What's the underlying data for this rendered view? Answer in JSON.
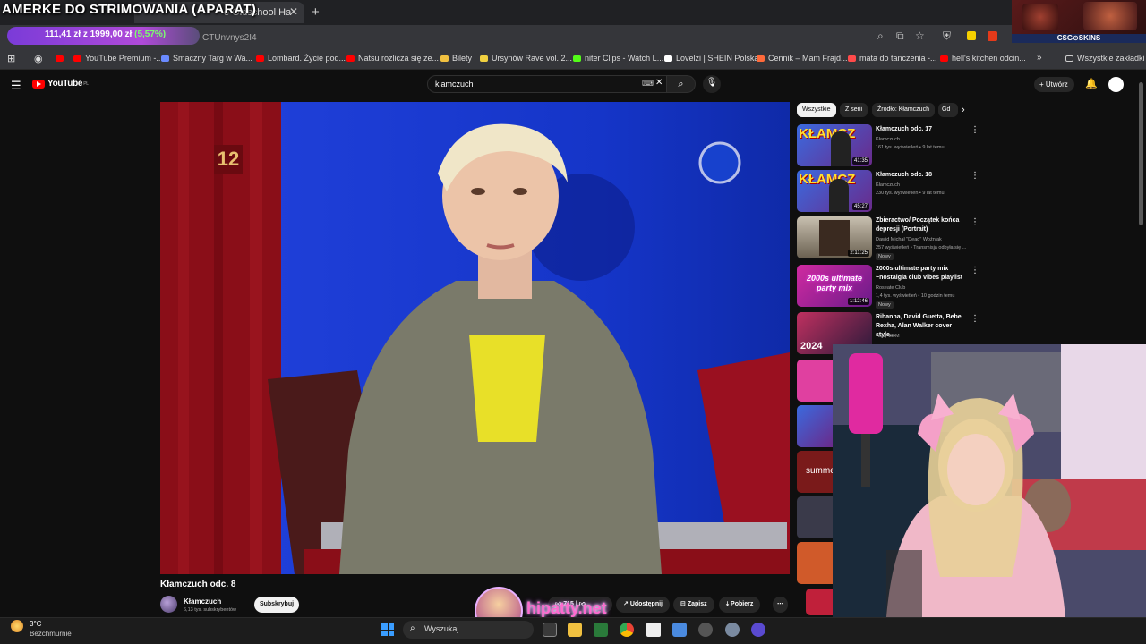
{
  "overlay": {
    "title": "AMERKE DO STRIMOWANIA (APARAT)",
    "goal_current": "111,41 zł",
    "goal_between": "z",
    "goal_target": "1999,00 zł",
    "goal_percent": "(5,57%)",
    "brand": "hipatty.net",
    "csgo_label": "CSG⊙SKINS"
  },
  "browser": {
    "tab_title": "e Oldschool Ha",
    "url_fragment": "CTUnvnys2I4",
    "bookmarks": [
      {
        "label": "YouTube Premium -...",
        "color": "#ff0000"
      },
      {
        "label": "Smaczny Targ w Wa...",
        "color": "#6a8aff"
      },
      {
        "label": "Lombard. Życie pod...",
        "color": "#ff0000"
      },
      {
        "label": "Natsu rozlicza się ze...",
        "color": "#ff0000"
      },
      {
        "label": "Bilety",
        "color": "#f0c040"
      },
      {
        "label": "Ursynów Rave vol. 2...",
        "color": "#f0d040"
      },
      {
        "label": "niter Clips - Watch L...",
        "color": "#53fc18"
      },
      {
        "label": "Lovelzi | SHEIN Polska",
        "color": "#ffffff"
      },
      {
        "label": "Cennik – Mam Frajd...",
        "color": "#ff6a3a"
      },
      {
        "label": "mata do tanczenia -...",
        "color": "#ff4a4a"
      },
      {
        "label": "hell's kitchen odcin...",
        "color": "#ff0000"
      }
    ],
    "all_bookmarks": "Wszystkie zakładki"
  },
  "youtube": {
    "logo": "YouTube",
    "logo_region": "PL",
    "search_value": "klamczuch",
    "create_label": "Utwórz",
    "video": {
      "title": "Kłamczuch odc. 8",
      "channel": "Kłamczuch",
      "subscribers": "6,13 tys. subskrybentów",
      "subscribe_label": "Subskrybuj",
      "likes": "715",
      "share_label": "Udostępnij",
      "save_label": "Zapisz",
      "download_label": "Pobierz",
      "ch_number": "12"
    },
    "chips": [
      "Wszystkie",
      "Z serii",
      "Źródło: Kłamczuch",
      "Gd"
    ],
    "sidebar": [
      {
        "title": "Kłamczuch odc. 17",
        "channel": "Kłamczuch",
        "meta": "161 tys. wyświetleń • 9 lat temu",
        "duration": "41:35",
        "badge": ""
      },
      {
        "title": "Kłamczuch odc. 18",
        "channel": "Kłamczuch",
        "meta": "230 tys. wyświetleń • 9 lat temu",
        "duration": "45:27",
        "badge": ""
      },
      {
        "title": "Zbieractwo/ Początek końca depresji (Portrait)",
        "channel": "Dawid Michał \"Dead\" Woźniak",
        "meta": "257 wyświetleń • Transmisja odbyła się ...",
        "duration": "2:11:25",
        "badge": "Nowy"
      },
      {
        "title": "2000s ultimate party mix ~nostalgia club vibes playlist",
        "channel": "Roseate Club",
        "meta": "1,4 tys. wyświetleń • 10 godzin temu",
        "duration": "1:12:46",
        "badge": "Nowy"
      },
      {
        "title": "Rihanna, David Guetta, Bebe Rexha, Alan Walker cover style...",
        "channel": "Tasty EDM",
        "meta": "",
        "duration": "",
        "badge": ""
      }
    ],
    "thumb_text_party": "2000s ultimate party mix",
    "thumb_text_2024": "2024",
    "thumb_text_summer": "summe"
  },
  "taskbar": {
    "temperature": "3°C",
    "weather": "Bezchmurnie",
    "search_placeholder": "Wyszukaj"
  }
}
